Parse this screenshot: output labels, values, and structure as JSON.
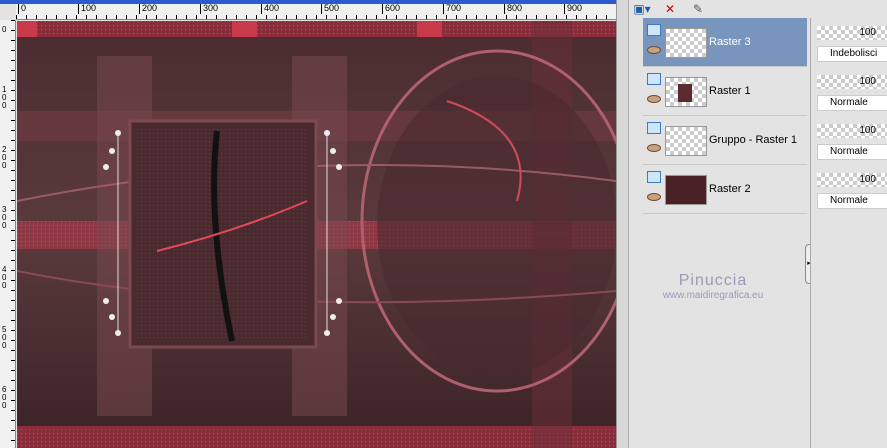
{
  "ruler": {
    "h": [
      "0",
      "100",
      "200",
      "300",
      "400",
      "500",
      "600",
      "700",
      "800",
      "900"
    ],
    "v": [
      "0",
      "100",
      "200",
      "300",
      "400",
      "500",
      "600"
    ]
  },
  "layers": [
    {
      "name": "Raster 3",
      "opacity": "100",
      "blend": "Indebolisci",
      "selected": true
    },
    {
      "name": "Raster 1",
      "opacity": "100",
      "blend": "Normale",
      "selected": false
    },
    {
      "name": "Gruppo - Raster 1",
      "opacity": "100",
      "blend": "Normale",
      "selected": false
    },
    {
      "name": "Raster 2",
      "opacity": "100",
      "blend": "Normale",
      "selected": false
    }
  ],
  "watermark": {
    "name": "Pinuccia",
    "url": "www.maidiregrafica.eu"
  },
  "colors": {
    "selection": "#7896bd",
    "canvas_dark": "#3a2024",
    "accent_red": "#c83a4a"
  }
}
